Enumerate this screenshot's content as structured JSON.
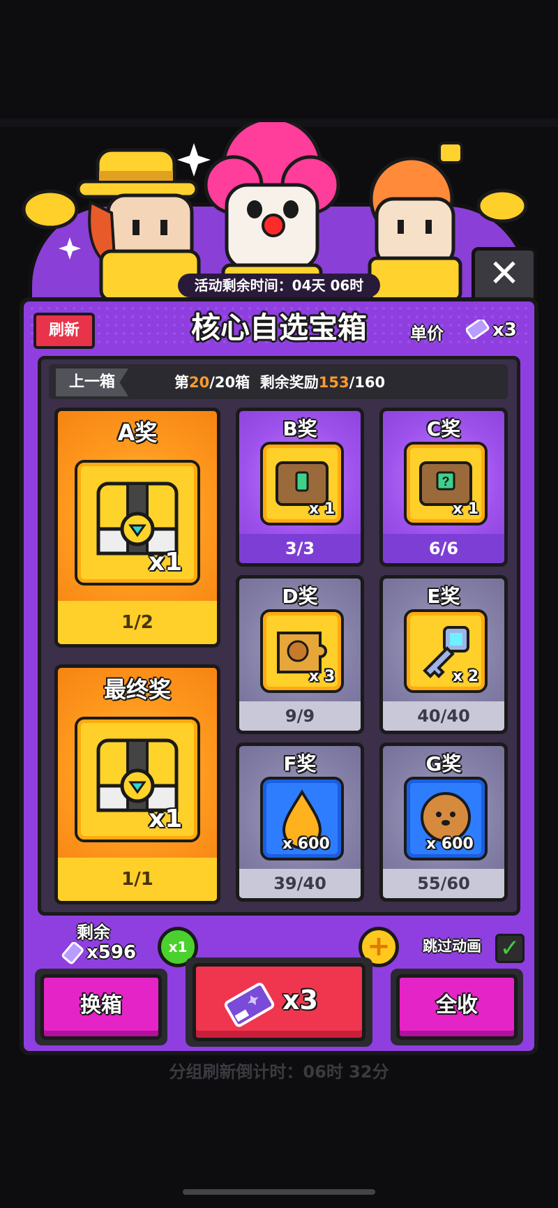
{
  "event": {
    "timer_text": "活动剩余时间：04天 06时"
  },
  "header": {
    "refresh_label": "刷新",
    "title": "核心自选宝箱",
    "unit_price_label": "单价",
    "unit_price_qty": "x3"
  },
  "box_nav": {
    "prev_label": "上一箱",
    "box_prefix": "第",
    "box_current": "20",
    "box_sep_total": "/20箱",
    "reward_prefix": "剩余奖励",
    "reward_remaining": "153",
    "reward_total": "/160"
  },
  "prizes": [
    {
      "id": "A",
      "name": "A奖",
      "icon": "diamond-chest-icon",
      "qty": "x1",
      "count": "1/2"
    },
    {
      "id": "final",
      "name": "最终奖",
      "icon": "diamond-chest-icon",
      "qty": "x1",
      "count": "1/1"
    },
    {
      "id": "B",
      "name": "B奖",
      "icon": "green-gem-chest-icon",
      "qty": "x 1",
      "count": "3/3"
    },
    {
      "id": "C",
      "name": "C奖",
      "icon": "mystery-chest-icon",
      "qty": "x 1",
      "count": "6/6"
    },
    {
      "id": "D",
      "name": "D奖",
      "icon": "character-puzzle-icon",
      "qty": "x 3",
      "count": "9/9"
    },
    {
      "id": "E",
      "name": "E奖",
      "icon": "key-icon",
      "qty": "x 2",
      "count": "40/40"
    },
    {
      "id": "F",
      "name": "F奖",
      "icon": "oil-drop-icon",
      "qty": "x 600",
      "count": "39/40"
    },
    {
      "id": "G",
      "name": "G奖",
      "icon": "dog-cookie-icon",
      "qty": "x 600",
      "count": "55/60"
    }
  ],
  "bottom": {
    "remaining_label": "剩余",
    "remaining_qty": "x596",
    "multiplier": "x1",
    "plus": "+",
    "skip_anim_label": "跳过动画",
    "skip_anim_checked": true,
    "swap_box_label": "换箱",
    "draw_qty": "x3",
    "collect_all_label": "全收"
  },
  "footer": {
    "group_refresh_text": "分组刷新倒计时：06时 32分"
  },
  "colors": {
    "panel_purple": "#8f3fe0",
    "prize_orange": "#ff9a1e",
    "accent_red": "#f0364f",
    "accent_magenta": "#e524c8",
    "highlight_orange": "#ff9a2e"
  }
}
